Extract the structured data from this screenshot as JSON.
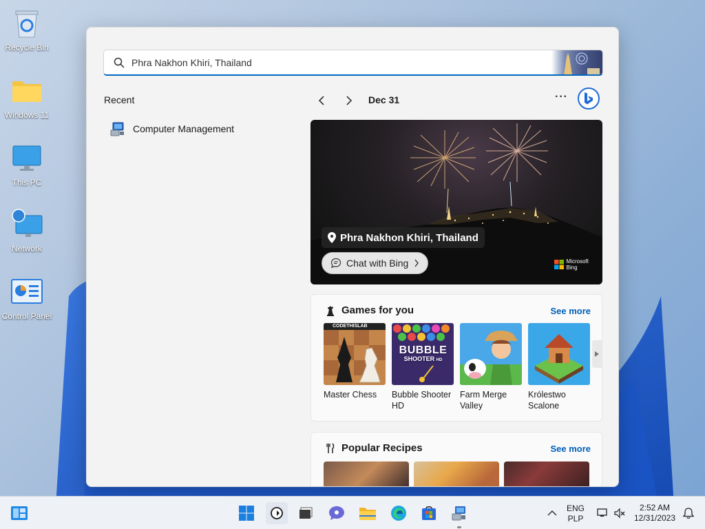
{
  "desktop": {
    "icons": [
      {
        "label": "Recycle Bin",
        "icon": "recycle-bin-icon"
      },
      {
        "label": "Windows 11",
        "icon": "folder-icon"
      },
      {
        "label": "This PC",
        "icon": "monitor-icon"
      },
      {
        "label": "Network",
        "icon": "network-icon"
      },
      {
        "label": "Control Panel",
        "icon": "control-panel-icon"
      }
    ]
  },
  "search": {
    "value": "Phra Nakhon Khiri, Thailand",
    "icon": "search-icon"
  },
  "recent": {
    "title": "Recent",
    "items": [
      {
        "label": "Computer Management",
        "icon": "computer-management-icon"
      }
    ]
  },
  "header": {
    "date": "Dec 31",
    "more": "···"
  },
  "hero": {
    "location": "Phra Nakhon Khiri, Thailand",
    "chat": "Chat with Bing",
    "brand_line1": "Microsoft",
    "brand_line2": "Bing"
  },
  "games": {
    "title": "Games for you",
    "see_more": "See more",
    "items": [
      {
        "name": "Master Chess",
        "badge": "CODETHISLAB"
      },
      {
        "name": "Bubble Shooter HD",
        "art_title": "BUBBLE",
        "art_sub": "SHOOTER",
        "art_hd": "HD"
      },
      {
        "name": "Farm Merge Valley"
      },
      {
        "name": "Królestwo Scalone"
      }
    ]
  },
  "recipes": {
    "title": "Popular Recipes",
    "see_more": "See more"
  },
  "taskbar": {
    "lang1": "ENG",
    "lang2": "PLP",
    "time": "2:52 AM",
    "date": "12/31/2023"
  },
  "colors": {
    "accent": "#0067c0",
    "link": "#005fb8"
  }
}
